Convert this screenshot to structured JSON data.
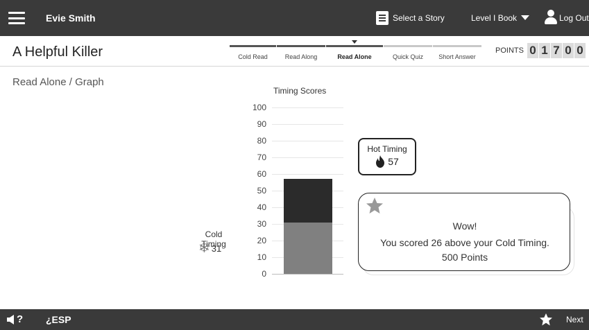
{
  "topbar": {
    "user_name": "Evie Smith",
    "select_story_label": "Select a Story",
    "level_label": "Level I Book",
    "logout_label": "Log Out"
  },
  "titlebar": {
    "story_title": "A Helpful Killer",
    "steps": [
      {
        "label": "Cold Read",
        "state": "done"
      },
      {
        "label": "Read Along",
        "state": "done"
      },
      {
        "label": "Read Alone",
        "state": "active"
      },
      {
        "label": "Quick Quiz",
        "state": "todo"
      },
      {
        "label": "Short Answer",
        "state": "todo"
      }
    ],
    "points_label": "POINTS",
    "points_digits": [
      "0",
      "1",
      "7",
      "0",
      "0"
    ]
  },
  "main": {
    "breadcrumb": "Read Alone / Graph",
    "cold_label": "Cold Timing",
    "cold_value": "31",
    "hot_label": "Hot Timing",
    "hot_value": "57",
    "message": {
      "line1": "Wow!",
      "line2": "You scored 26 above your Cold Timing.",
      "line3": "500 Points"
    }
  },
  "chart_data": {
    "type": "bar",
    "title": "Timing Scores",
    "ylim": [
      0,
      100
    ],
    "yticks": [
      0,
      10,
      20,
      30,
      40,
      50,
      60,
      70,
      80,
      90,
      100
    ],
    "stacked": true,
    "series": [
      {
        "name": "Cold Timing",
        "value": 31,
        "color": "#808080"
      },
      {
        "name": "Hot Timing",
        "value": 57,
        "color": "#2b2b2b"
      }
    ],
    "grid": true
  },
  "bottombar": {
    "esp_label": "¿ESP",
    "next_label": "Next"
  },
  "colors": {
    "bar_background": "#3a3a3a",
    "cold_bar": "#808080",
    "hot_bar": "#2b2b2b"
  }
}
